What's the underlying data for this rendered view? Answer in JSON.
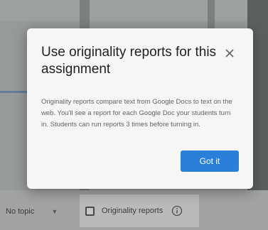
{
  "dialog": {
    "title": "Use originality reports for this assignment",
    "body": "Originality reports compare text from Google Docs to text on the web. You'll see a report for each Google Doc your students turn in. Students can run reports 3 times before turning in.",
    "confirm_label": "Got it",
    "close_icon": "close-icon"
  },
  "toolbar": {
    "topic_value": "No topic",
    "originality_label": "Originality reports",
    "originality_checked": false,
    "info_icon": "info-icon"
  },
  "colors": {
    "accent": "#2a7fd8",
    "dialog_bg": "#f6f6f5",
    "scrim": "#5a5c5c"
  }
}
